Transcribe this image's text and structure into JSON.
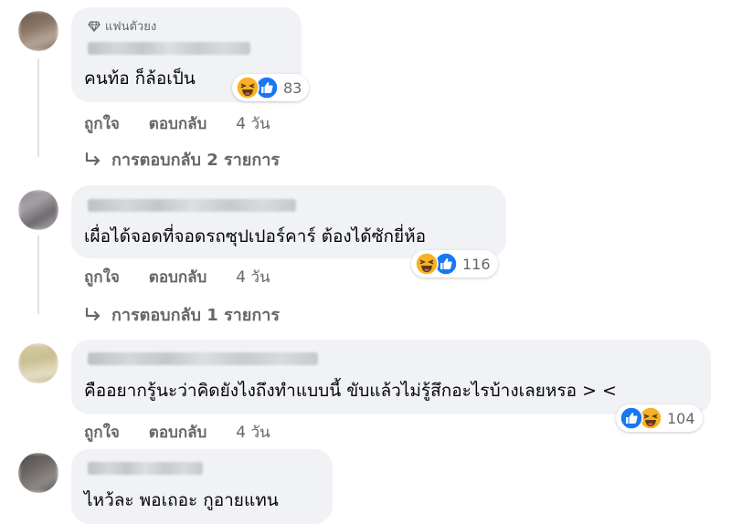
{
  "colors": {
    "bubble_bg": "#f0f2f5",
    "meta_text": "#65676b",
    "like_blue": "#1877f2",
    "haha_yellow": "#f7b125"
  },
  "comments": [
    {
      "badge_icon": "diamond-icon",
      "badge_text": "แฟนตัวยง",
      "text": "คนท้อ ก็ล้อเป็น",
      "reactions": [
        "haha",
        "like"
      ],
      "reaction_count": "83",
      "actions": {
        "like": "ถูกใจ",
        "reply": "ตอบกลับ",
        "time": "4 วัน"
      },
      "replies_link": "การตอบกลับ 2 รายการ"
    },
    {
      "text": "เผื่อได้จอดที่จอดรถซุปเปอร์คาร์ ต้องได้ซักยี่ห้อ",
      "reactions": [
        "haha",
        "like"
      ],
      "reaction_count": "116",
      "actions": {
        "like": "ถูกใจ",
        "reply": "ตอบกลับ",
        "time": "4 วัน"
      },
      "replies_link": "การตอบกลับ 1 รายการ"
    },
    {
      "text": "คืออยากรู้นะว่าคิดยังไงถึงทำแบบนี้ ขับแล้วไม่รู้สึกอะไรบ้างเลยหรอ > <",
      "reactions": [
        "like",
        "haha"
      ],
      "reaction_count": "104",
      "actions": {
        "like": "ถูกใจ",
        "reply": "ตอบกลับ",
        "time": "4 วัน"
      }
    },
    {
      "text": "ไหว้ละ พอเถอะ กูอายแทน"
    }
  ]
}
